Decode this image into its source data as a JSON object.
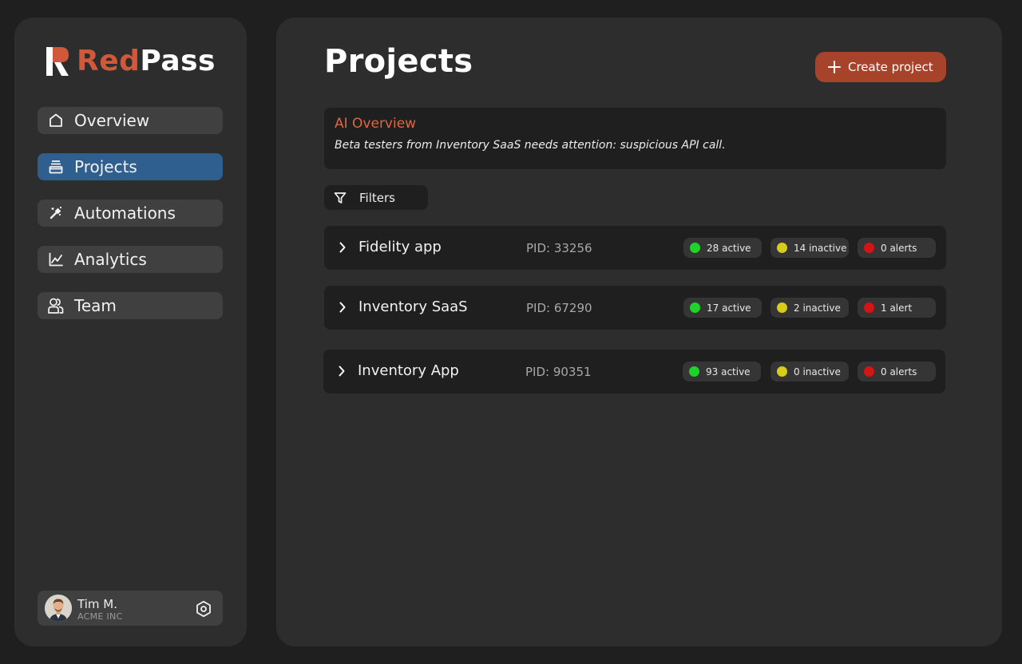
{
  "brand": {
    "name_part1": "Red",
    "name_part2": "Pass",
    "color_accent": "#d2583a"
  },
  "sidebar": {
    "items": [
      {
        "label": "Overview",
        "icon": "home-icon",
        "active": false
      },
      {
        "label": "Projects",
        "icon": "inbox-icon",
        "active": true
      },
      {
        "label": "Automations",
        "icon": "magic-wand-icon",
        "active": false
      },
      {
        "label": "Analytics",
        "icon": "line-chart-icon",
        "active": false
      },
      {
        "label": "Team",
        "icon": "users-icon",
        "active": false
      }
    ],
    "active_color": "#2f5f8e"
  },
  "user": {
    "name": "Tim M.",
    "org": "ACME INC",
    "settings_icon": "settings-hex-icon"
  },
  "main": {
    "title": "Projects",
    "create_label": "Create project",
    "create_color": "#a8432b",
    "ai_overview": {
      "title": "AI Overview",
      "text": "Beta testers from Inventory SaaS needs attention: suspicious API call."
    },
    "filters_label": "Filters"
  },
  "projects": [
    {
      "name": "Fidelity app",
      "pid": "PID: 33256",
      "active": "28 active",
      "inactive": "14 inactive",
      "alerts": "0 alerts"
    },
    {
      "name": "Inventory SaaS",
      "pid": "PID: 67290",
      "active": "17 active",
      "inactive": "2 inactive",
      "alerts": "1 alert"
    },
    {
      "name": "Inventory App",
      "pid": "PID: 90351",
      "active": "93 active",
      "inactive": "0 inactive",
      "alerts": "0 alerts"
    }
  ],
  "status_colors": {
    "active": "#1ed32a",
    "inactive": "#d8cc1a",
    "alert": "#d41515"
  }
}
